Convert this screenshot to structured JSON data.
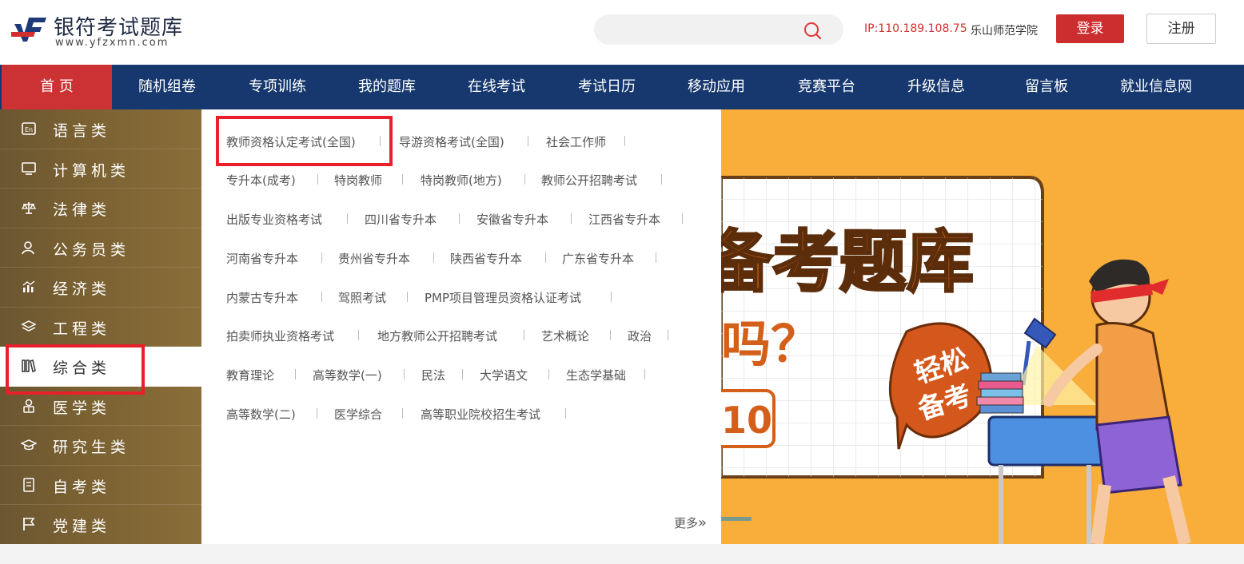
{
  "header": {
    "logo_title": "银符考试题库",
    "logo_url": "www.yfzxmn.com",
    "search_placeholder": "",
    "ip": "IP:110.189.108.75",
    "school": "乐山师范学院",
    "login_label": "登录",
    "register_label": "注册"
  },
  "nav": {
    "items": [
      {
        "label": "首  页"
      },
      {
        "label": "随机组卷"
      },
      {
        "label": "专项训练"
      },
      {
        "label": "我的题库"
      },
      {
        "label": "在线考试"
      },
      {
        "label": "考试日历"
      },
      {
        "label": "移动应用"
      },
      {
        "label": "竞赛平台"
      },
      {
        "label": "升级信息"
      },
      {
        "label": "留言板"
      },
      {
        "label": "就业信息网"
      }
    ]
  },
  "sidebar": {
    "items": [
      {
        "label": "语言类",
        "icon": "language-icon"
      },
      {
        "label": "计算机类",
        "icon": "monitor-icon"
      },
      {
        "label": "法律类",
        "icon": "scales-icon"
      },
      {
        "label": "公务员类",
        "icon": "person-icon"
      },
      {
        "label": "经济类",
        "icon": "chart-icon"
      },
      {
        "label": "工程类",
        "icon": "layers-icon"
      },
      {
        "label": "综合类",
        "icon": "books-icon"
      },
      {
        "label": "医学类",
        "icon": "doctor-icon"
      },
      {
        "label": "研究生类",
        "icon": "graduation-cap-icon"
      },
      {
        "label": "自考类",
        "icon": "document-icon"
      },
      {
        "label": "党建类",
        "icon": "flag-icon"
      }
    ]
  },
  "dropdown": {
    "rows": [
      [
        "教师资格认定考试(全国)",
        "导游资格考试(全国)",
        "社会工作师"
      ],
      [
        "专升本(成考)",
        "特岗教师",
        "特岗教师(地方)",
        "教师公开招聘考试"
      ],
      [
        "出版专业资格考试",
        "四川省专升本",
        "安徽省专升本",
        "江西省专升本"
      ],
      [
        "河南省专升本",
        "贵州省专升本",
        "陕西省专升本",
        "广东省专升本"
      ],
      [
        "内蒙古专升本",
        "驾照考试",
        "PMP项目管理员资格认证考试"
      ],
      [
        "拍卖师执业资格考试",
        "地方教师公开招聘考试",
        "艺术概论",
        "政治"
      ],
      [
        "教育理论",
        "高等数学(一)",
        "民法",
        "大学语文",
        "生态学基础"
      ],
      [
        "高等数学(二)",
        "医学综合",
        "高等职业院校招生考试"
      ]
    ],
    "more_label": "更多",
    "more_icon": "»"
  },
  "banner": {
    "headline": "备考题库",
    "question": "吗？",
    "badge_line1": "轻松",
    "badge_line2": "备考",
    "number_fragment": "10"
  },
  "colors": {
    "nav_bg": "#16386e",
    "nav_active": "#cc3134",
    "login_bg": "#cc2d2f",
    "ip_text": "#d0302e",
    "banner_bg": "#f9ad3a",
    "highlight_border": "#e8202a"
  }
}
